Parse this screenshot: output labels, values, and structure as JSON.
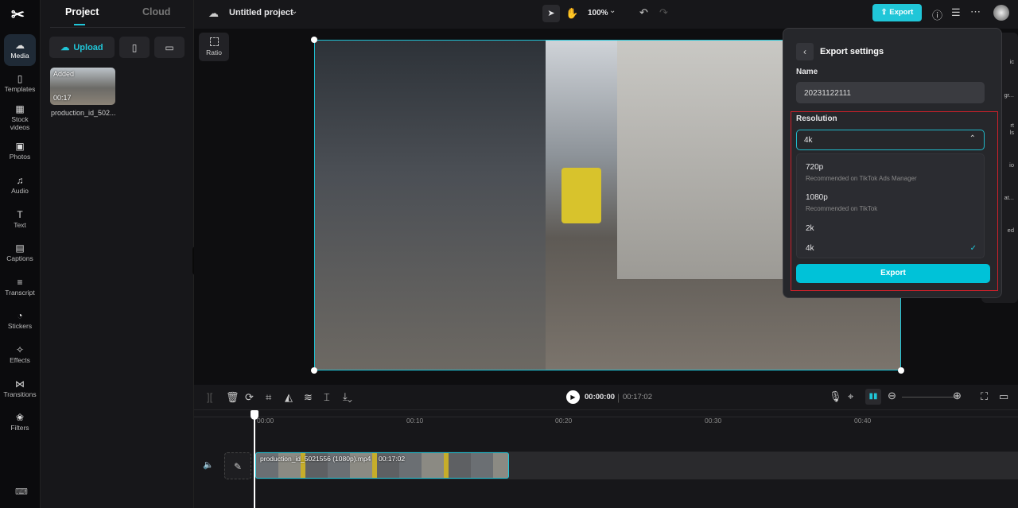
{
  "rail": {
    "items": [
      {
        "label": "Media",
        "icon": "cloud-upload-icon"
      },
      {
        "label": "Templates",
        "icon": "templates-icon"
      },
      {
        "label": "Stock videos",
        "icon": "film-icon"
      },
      {
        "label": "Photos",
        "icon": "image-icon"
      },
      {
        "label": "Audio",
        "icon": "music-icon"
      },
      {
        "label": "Text",
        "icon": "text-icon"
      },
      {
        "label": "Captions",
        "icon": "captions-icon"
      },
      {
        "label": "Transcript",
        "icon": "transcript-icon"
      },
      {
        "label": "Stickers",
        "icon": "sticker-icon"
      },
      {
        "label": "Effects",
        "icon": "effects-icon"
      },
      {
        "label": "Transitions",
        "icon": "transitions-icon"
      },
      {
        "label": "Filters",
        "icon": "filters-icon"
      }
    ]
  },
  "panel": {
    "tabs": [
      "Project",
      "Cloud"
    ],
    "upload": "Upload",
    "media": {
      "badge": "Added",
      "duration": "00:17",
      "name": "production_id_502..."
    }
  },
  "topbar": {
    "title": "Untitled project",
    "zoom": "100%",
    "export": "Export"
  },
  "canvas": {
    "ratio": "Ratio"
  },
  "export": {
    "title": "Export settings",
    "name_label": "Name",
    "name_value": "20231122111",
    "resolution_label": "Resolution",
    "selected": "4k",
    "options": [
      {
        "label": "720p",
        "desc": "Recommended on TikTok Ads Manager"
      },
      {
        "label": "1080p",
        "desc": "Recommended on TikTok"
      },
      {
        "label": "2k",
        "desc": ""
      },
      {
        "label": "4k",
        "desc": ""
      }
    ],
    "button": "Export",
    "highlight": "#d0202a",
    "accent": "#00c2d8"
  },
  "side": [
    "ic",
    "gr...",
    "rt",
    "ls",
    "io",
    "at...",
    "ed"
  ],
  "player": {
    "current": "00:00:00",
    "total": "00:17:02"
  },
  "timeline": {
    "ticks": [
      "00:00",
      "00:10",
      "00:20",
      "00:30",
      "00:40"
    ],
    "clip": {
      "name": "production_id_5021556 (1080p).mp4",
      "duration": "00:17:02"
    }
  }
}
